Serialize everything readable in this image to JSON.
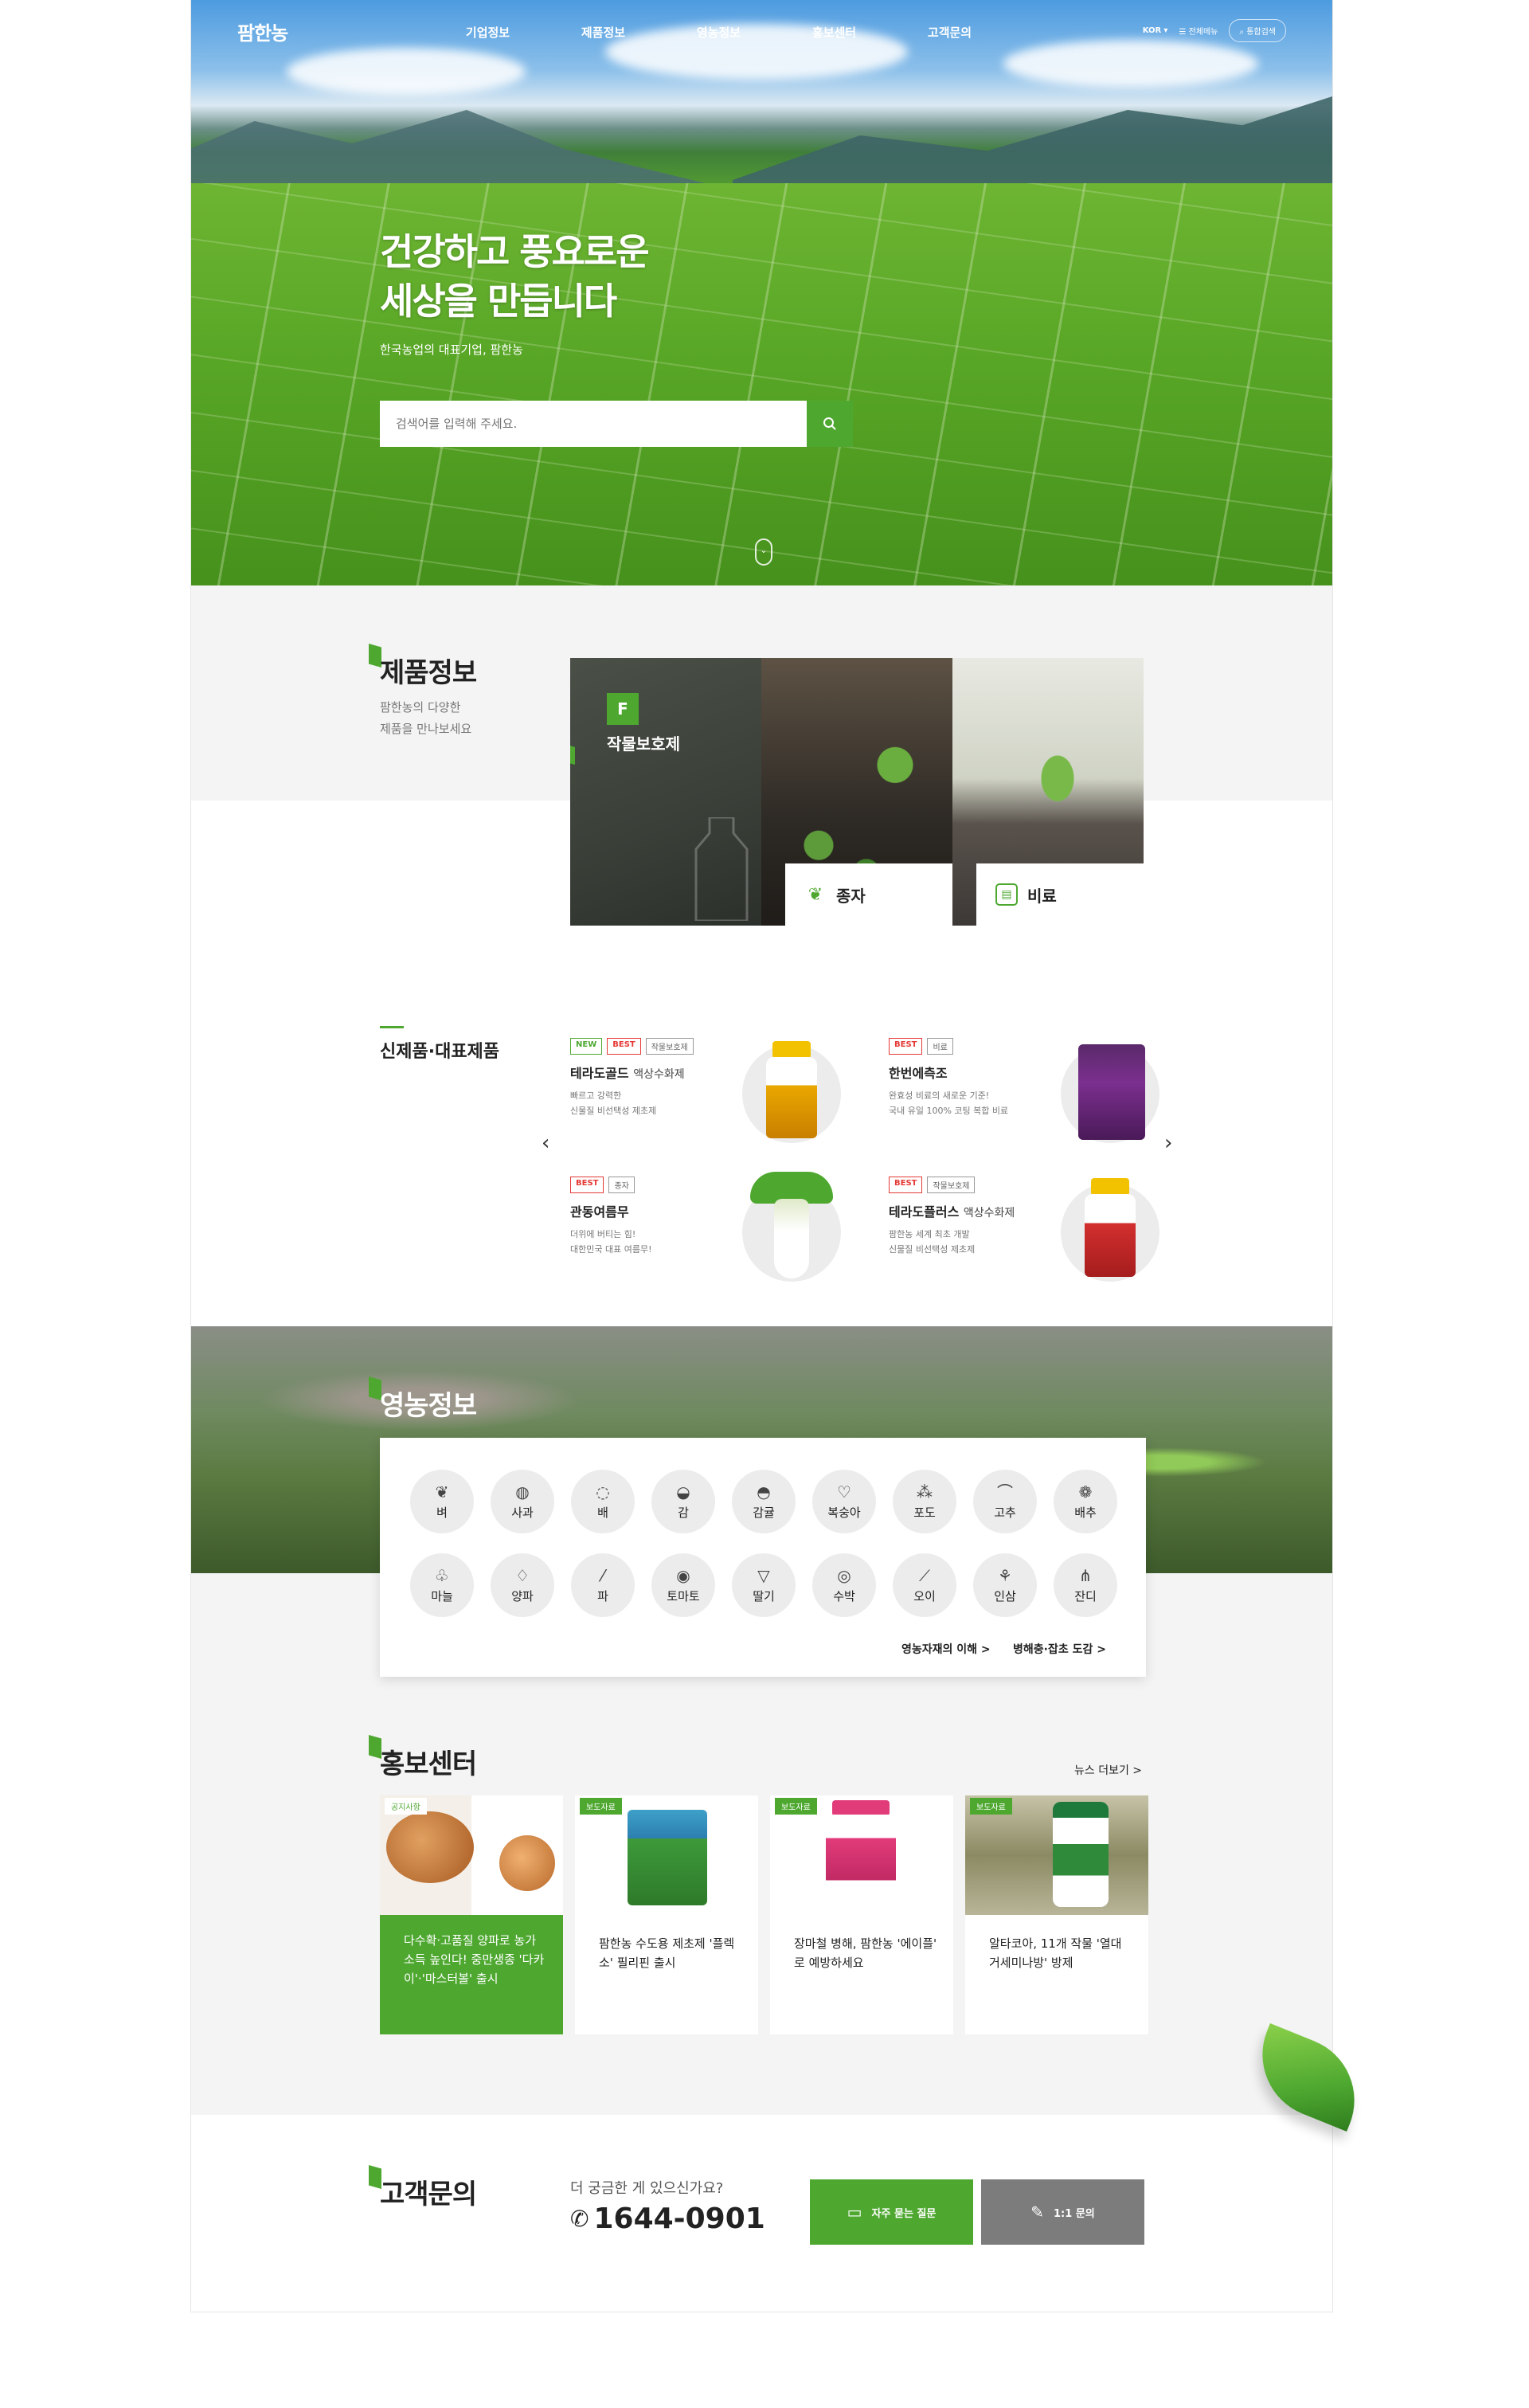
{
  "header": {
    "logo": "팜한농",
    "nav": [
      "기업정보",
      "제품정보",
      "영농정보",
      "홍보센터",
      "고객문의"
    ],
    "lang": "KOR",
    "menu_all": "전체메뉴",
    "search_all": "통합검색"
  },
  "hero": {
    "title_line1": "건강하고 풍요로운",
    "title_line2": "세상을 만듭니다",
    "subtitle": "한국농업의 대표기업, 팜한농",
    "search_placeholder": "검색어를 입력해 주세요."
  },
  "products": {
    "title": "제품정보",
    "desc_line1": "팜한농의 다양한",
    "desc_line2": "제품을 만나보세요",
    "tiles": [
      {
        "label": "작물보호제",
        "icon": "crop-protection-icon"
      },
      {
        "label": "종자",
        "icon": "sprout-icon"
      },
      {
        "label": "비료",
        "icon": "fertilizer-icon"
      }
    ]
  },
  "new_products": {
    "title": "신제품·대표제품",
    "items": [
      {
        "badges": [
          "NEW",
          "BEST",
          "작물보호제"
        ],
        "name": "테라도골드",
        "type": "액상수화제",
        "desc1": "빠르고 강력한",
        "desc2": "신물질 비선택성 제초제"
      },
      {
        "badges": [
          "BEST",
          "비료"
        ],
        "name": "한번에측조",
        "type": "",
        "desc1": "완효성 비료의 새로운 기준!",
        "desc2": "국내 유일 100% 코팅 복합 비료"
      },
      {
        "badges": [
          "BEST",
          "종자"
        ],
        "name": "관동여름무",
        "type": "",
        "desc1": "더위에 버티는 힘!",
        "desc2": "대한민국 대표 여름무!"
      },
      {
        "badges": [
          "BEST",
          "작물보호제"
        ],
        "name": "테라도플러스",
        "type": "액상수화제",
        "desc1": "팜한농 세계 최초 개발",
        "desc2": "신물질 비선택성 제초제"
      }
    ]
  },
  "farming": {
    "title": "영농정보",
    "crops_row1": [
      {
        "label": "벼",
        "icon": "rice-icon"
      },
      {
        "label": "사과",
        "icon": "apple-icon"
      },
      {
        "label": "배",
        "icon": "pear-icon"
      },
      {
        "label": "감",
        "icon": "persimmon-icon"
      },
      {
        "label": "감귤",
        "icon": "tangerine-icon"
      },
      {
        "label": "복숭아",
        "icon": "peach-icon"
      },
      {
        "label": "포도",
        "icon": "grape-icon"
      },
      {
        "label": "고추",
        "icon": "pepper-icon"
      },
      {
        "label": "배추",
        "icon": "cabbage-icon"
      }
    ],
    "crops_row2": [
      {
        "label": "마늘",
        "icon": "garlic-icon"
      },
      {
        "label": "양파",
        "icon": "onion-icon"
      },
      {
        "label": "파",
        "icon": "green-onion-icon"
      },
      {
        "label": "토마토",
        "icon": "tomato-icon"
      },
      {
        "label": "딸기",
        "icon": "strawberry-icon"
      },
      {
        "label": "수박",
        "icon": "watermelon-icon"
      },
      {
        "label": "오이",
        "icon": "cucumber-icon"
      },
      {
        "label": "인삼",
        "icon": "ginseng-icon"
      },
      {
        "label": "잔디",
        "icon": "grass-icon"
      }
    ],
    "link1": "영농자재의 이해 >",
    "link2": "병해충·잡초 도감 >"
  },
  "news": {
    "title": "홍보센터",
    "more": "뉴스 더보기 >",
    "items": [
      {
        "tag": "공지사항",
        "text": "다수확·고품질 양파로 농가 소득 높인다! 중만생종 '다카이'·'마스터볼' 출시"
      },
      {
        "tag": "보도자료",
        "text": "팜한농 수도용 제초제 '플렉소' 필리핀 출시"
      },
      {
        "tag": "보도자료",
        "text": "장마철 병해, 팜한농 '에이플' 로 예방하세요"
      },
      {
        "tag": "보도자료",
        "text": "알타코아, 11개 작물 '열대거세미나방' 방제"
      }
    ]
  },
  "contact": {
    "title": "고객문의",
    "question": "더 궁금한 게 있으신가요?",
    "phone": "1644-0901",
    "faq": "자주 묻는 질문",
    "qna": "1:1 문의"
  }
}
